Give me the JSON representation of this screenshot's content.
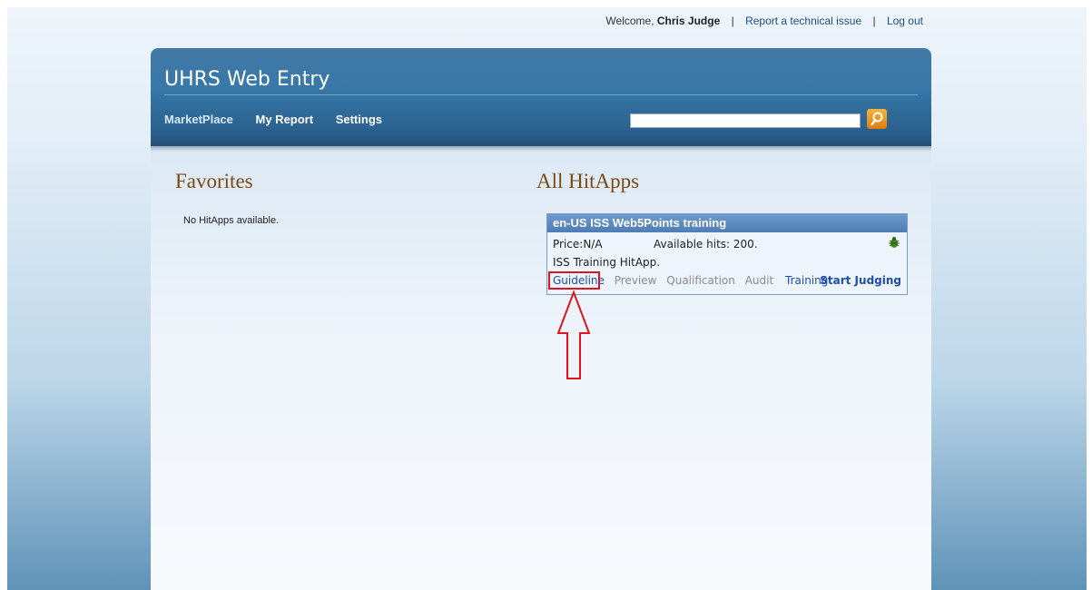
{
  "toplinks": {
    "welcome": "Welcome,",
    "user": "Chris Judge",
    "sep1": "|",
    "report": "Report a technical issue",
    "sep2": "|",
    "logout": "Log out"
  },
  "header": {
    "title": "UHRS Web Entry",
    "nav": [
      "MarketPlace",
      "My Report",
      "Settings"
    ],
    "search": {
      "value": "",
      "placeholder": ""
    }
  },
  "favorites": {
    "title": "Favorites",
    "empty_text": "No HitApps available."
  },
  "all_hitapps": {
    "title": "All HitApps",
    "apps": [
      {
        "name": "en-US ISS Web5Points training",
        "price": "Price:N/A",
        "available": "Available hits: 200.",
        "description": "ISS Training HitApp.",
        "links": {
          "guideline": "Guideline",
          "preview": "Preview",
          "qualification": "Qualification",
          "audit": "Audit",
          "training": "Training",
          "start": "Start Judging"
        }
      }
    ]
  },
  "colors": {
    "header": "#2e6a9a",
    "section_title": "#7a4a12",
    "link": "#1f4ea8",
    "annotation": "#e0141e",
    "search_button": "#f0961f"
  }
}
